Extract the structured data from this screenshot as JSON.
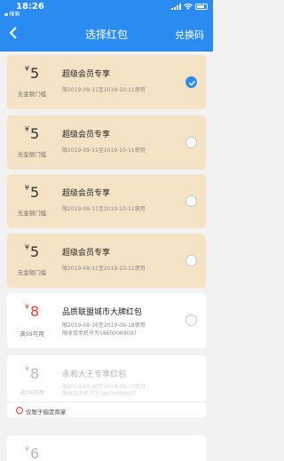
{
  "status": {
    "time": "18:26",
    "back_app": "◀ 搜索"
  },
  "nav": {
    "title": "选择红包",
    "action": "兑换码"
  },
  "currency": "¥",
  "cards": [
    {
      "amount": "5",
      "condition": "无金额门槛",
      "title": "超级会员专享",
      "date": "限2019-09-11至2019-10-11使用",
      "selected": true
    },
    {
      "amount": "5",
      "condition": "无金额门槛",
      "title": "超级会员专享",
      "date": "限2019-09-11至2019-10-11使用",
      "selected": false
    },
    {
      "amount": "5",
      "condition": "无金额门槛",
      "title": "超级会员专享",
      "date": "限2019-09-11至2019-10-11使用",
      "selected": false
    },
    {
      "amount": "5",
      "condition": "无金额门槛",
      "title": "超级会员专享",
      "date": "限2019-09-11至2019-10-11使用",
      "selected": false
    },
    {
      "amount": "8",
      "condition": "满59可用",
      "title": "品质联盟城市大牌红包",
      "date": "限2019-09-16至2019-09-18使用",
      "note": "限收货手机号为18600069097",
      "selected": false
    },
    {
      "amount": "8",
      "condition": "满38可用",
      "title": "永和大王专享红包",
      "date": "限2019-09-16至2019-09-17使用",
      "note": "限收货手机号为18600069097",
      "restriction": "仅限于指定商家"
    },
    {
      "amount": "6",
      "condition": "",
      "title": "",
      "date": ""
    }
  ],
  "colors": {
    "accent": "#2a8cf0",
    "beige": "#f4e3c5",
    "red": "#e8413c"
  }
}
